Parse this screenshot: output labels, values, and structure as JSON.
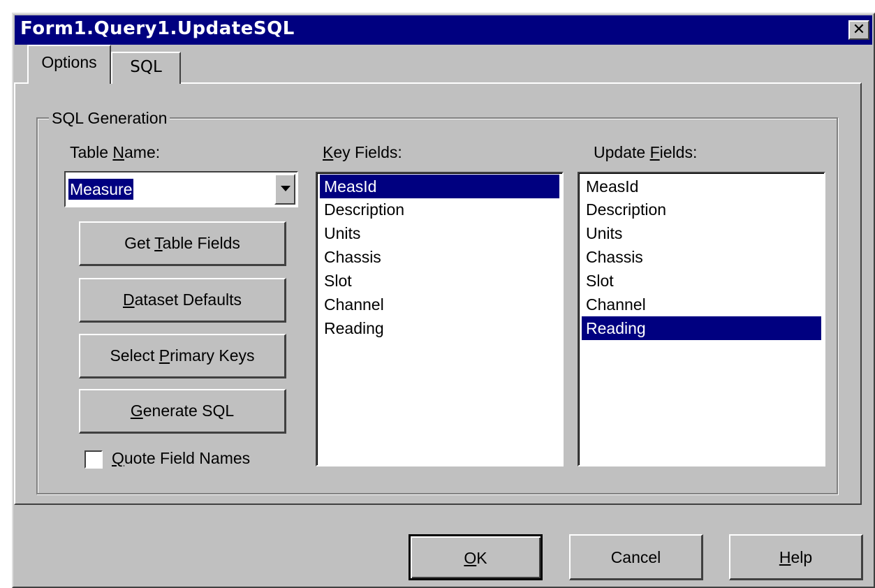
{
  "window": {
    "title": "Form1.Query1.UpdateSQL",
    "close_glyph": "✕"
  },
  "tabs": [
    {
      "label": "Options",
      "selected": true
    },
    {
      "label": "SQL",
      "selected": false
    }
  ],
  "group": {
    "title": "SQL Generation"
  },
  "table_name": {
    "label_pre": "Table ",
    "label_key": "N",
    "label_post": "ame:",
    "value": "Measure"
  },
  "buttons": {
    "get_table_fields": {
      "pre": "Get ",
      "key": "T",
      "post": "able Fields"
    },
    "dataset_defaults": {
      "pre": "",
      "key": "D",
      "post": "ataset Defaults"
    },
    "select_primary_keys": {
      "pre": "Select ",
      "key": "P",
      "post": "rimary Keys"
    },
    "generate_sql": {
      "pre": "",
      "key": "G",
      "post": "enerate SQL"
    }
  },
  "quote_field_names": {
    "pre": "",
    "key": "Q",
    "post": "uote Field Names",
    "checked": false
  },
  "key_fields": {
    "label_pre": "",
    "label_key": "K",
    "label_post": "ey Fields:",
    "items": [
      "MeasId",
      "Description",
      "Units",
      "Chassis",
      "Slot",
      "Channel",
      "Reading"
    ],
    "selected": [
      "MeasId"
    ]
  },
  "update_fields": {
    "label_pre": "Upd",
    "label_key": "a",
    "label_post": "te Fields:",
    "label_pre2": "ate ",
    "label_key2": "F",
    "label_post2": "ields:",
    "items": [
      "MeasId",
      "Description",
      "Units",
      "Chassis",
      "Slot",
      "Channel",
      "Reading"
    ],
    "selected": [
      "Reading"
    ]
  },
  "footer": {
    "ok": {
      "pre": "",
      "key": "O",
      "post": "K"
    },
    "cancel": {
      "label": "Cancel"
    },
    "help": {
      "pre": "",
      "key": "H",
      "post": "elp"
    }
  },
  "colors": {
    "titlebar": "#000080",
    "face": "#c0c0c0",
    "selection": "#000080"
  }
}
